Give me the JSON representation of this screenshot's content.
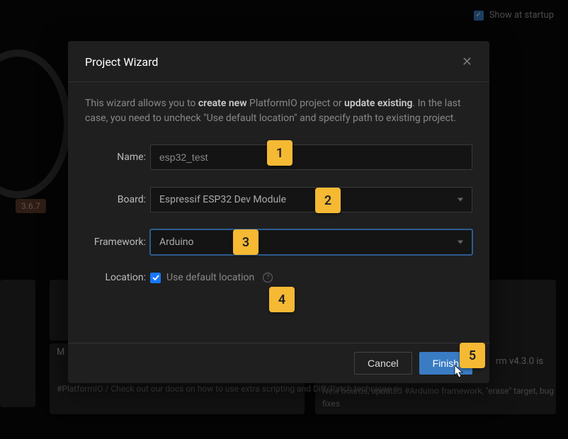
{
  "header": {
    "show_at_startup_label": "Show at startup"
  },
  "background": {
    "version": "3.6.7",
    "midcard_line1": "M",
    "midcard_line2": "#PlatformIO / Check out our docs on how to use extra scripting and Diff/Patch technique ✏",
    "rightcard_version": "rm v4.3.0 is",
    "rightcard_line": "New boards, updated #Arduino framework, \"erase\" target, bug fixes"
  },
  "modal": {
    "title": "Project Wizard",
    "intro_pre": "This wizard allows you to ",
    "intro_bold1": "create new",
    "intro_mid": " PlatformIO project or ",
    "intro_bold2": "update existing",
    "intro_post": ". In the last case, you need to uncheck \"Use default location\" and specify path to existing project.",
    "name_label": "Name:",
    "name_value": "esp32_test",
    "board_label": "Board:",
    "board_value": "Espressif ESP32 Dev Module",
    "framework_label": "Framework:",
    "framework_value": "Arduino",
    "location_label": "Location:",
    "location_checkbox_label": "Use default location",
    "cancel_label": "Cancel",
    "finish_label": "Finish"
  },
  "annotations": {
    "a1": "1",
    "a2": "2",
    "a3": "3",
    "a4": "4",
    "a5": "5"
  }
}
